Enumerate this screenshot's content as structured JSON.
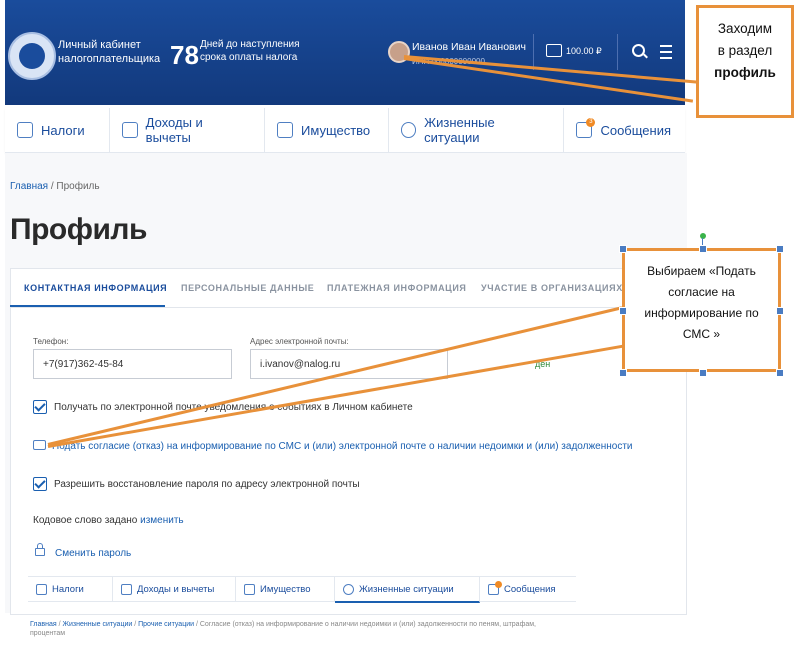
{
  "header": {
    "cabinet_title_line1": "Личный кабинет",
    "cabinet_title_line2": "налогоплательщика",
    "days_number": "78",
    "days_text_line1": "Дней до наступления",
    "days_text_line2": "срока оплаты налога",
    "user_name": "Иванов Иван Иванович",
    "user_inn": "ИНН 000000000000",
    "balance": "100.00 ₽"
  },
  "nav": {
    "items": [
      {
        "label": "Налоги",
        "icon": "taxes-icon"
      },
      {
        "label": "Доходы и вычеты",
        "icon": "income-icon"
      },
      {
        "label": "Имущество",
        "icon": "property-icon"
      },
      {
        "label": "Жизненные ситуации",
        "icon": "life-situations-icon"
      },
      {
        "label": "Сообщения",
        "icon": "messages-icon",
        "badge": "3"
      }
    ]
  },
  "breadcrumb": {
    "home": "Главная",
    "separator": " / ",
    "current": "Профиль"
  },
  "page_title": "Профиль",
  "tabs": [
    {
      "label": "КОНТАКТНАЯ ИНФОРМАЦИЯ",
      "active": true
    },
    {
      "label": "ПЕРСОНАЛЬНЫЕ ДАННЫЕ"
    },
    {
      "label": "ПЛАТЕЖНАЯ ИНФОРМАЦИЯ"
    },
    {
      "label": "УЧАСТИЕ В ОРГАНИЗАЦИЯХ"
    }
  ],
  "form": {
    "phone_label": "Телефон:",
    "phone_value": "+7(917)362-45-84",
    "email_label": "Адрес электронной почты:",
    "email_value": "i.ivanov@nalog.ru",
    "email_confirm_fragment": "ден",
    "checkbox_notify_label": "Получать по электронной почте уведомления о событиях в Личном кабинете",
    "consent_link": "Подать согласие (отказ) на информирование по СМС и (или) электронной почте о наличии недоимки и (или) задолженности",
    "checkbox_restore_label": "Разрешить восстановление пароля по адресу электронной почты",
    "codeword_text": "Кодовое слово задано",
    "codeword_link": "изменить",
    "change_password": "Сменить пароль"
  },
  "bottom_nav": {
    "items": [
      {
        "label": "Налоги"
      },
      {
        "label": "Доходы и вычеты"
      },
      {
        "label": "Имущество"
      },
      {
        "label": "Жизненные ситуации",
        "active": true
      },
      {
        "label": "Сообщения"
      }
    ]
  },
  "bottom_breadcrumb": {
    "home": "Главная",
    "life": "Жизненные ситуации",
    "other": "Прочие ситуации",
    "current": "Согласие (отказ) на информирование о наличии недоимки и (или) задолженности по пеням, штрафам, процентам",
    "sep": " / "
  },
  "callouts": {
    "first_line1": "Заходим",
    "first_line2": "в раздел",
    "first_line3": "профиль",
    "second_line1": "Выбираем «Подать",
    "second_line2": "согласие на",
    "second_line3": "информирование по",
    "second_line4": "СМС »"
  },
  "colors": {
    "brand_blue": "#1a4c9c",
    "link_blue": "#1a5fb0",
    "callout_orange": "#e8913a",
    "badge_orange": "#f08a24"
  }
}
